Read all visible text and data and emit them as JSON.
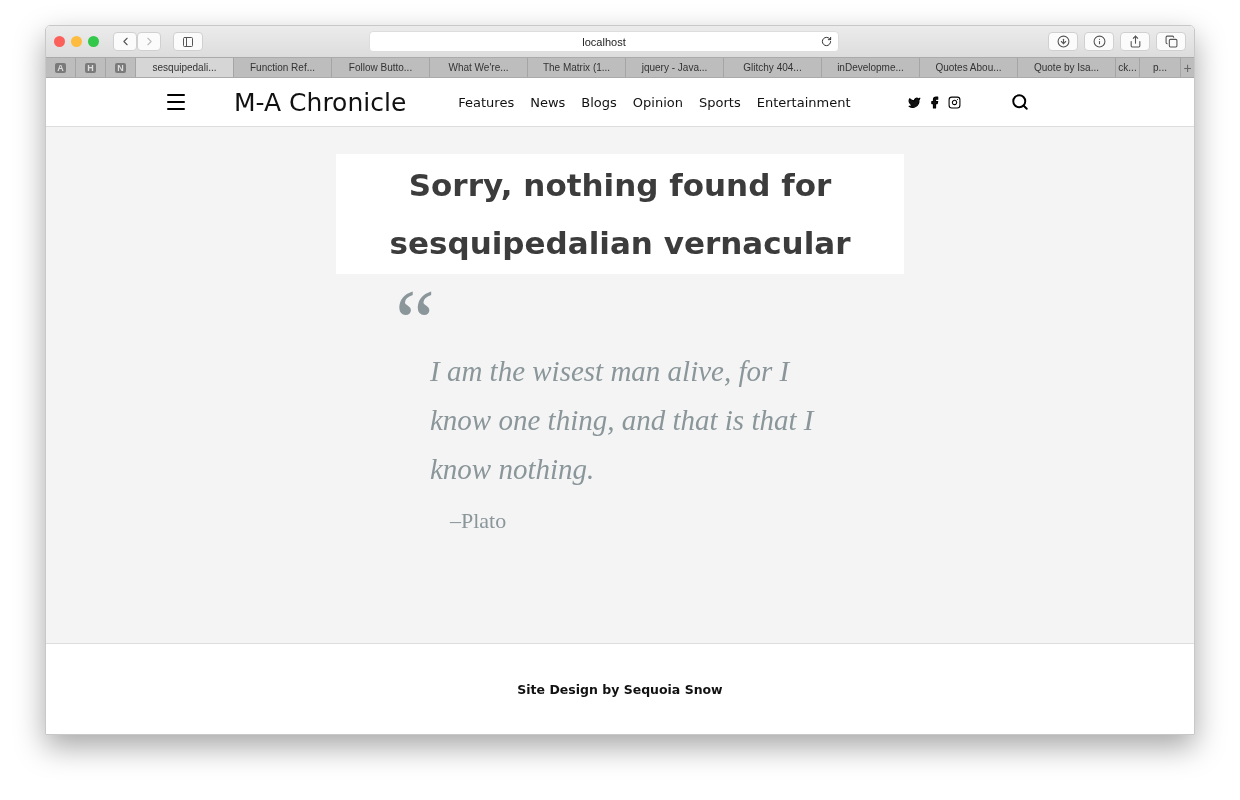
{
  "browser": {
    "address": "localhost",
    "pinned_tabs": [
      "A",
      "H",
      "N"
    ],
    "tabs": [
      {
        "label": "sesquipedali...",
        "selected": true
      },
      {
        "label": "Function Ref...",
        "selected": false
      },
      {
        "label": "Follow Butto...",
        "selected": false
      },
      {
        "label": "What We're...",
        "selected": false
      },
      {
        "label": "The Matrix (1...",
        "selected": false
      },
      {
        "label": "jquery - Java...",
        "selected": false
      },
      {
        "label": "Glitchy 404...",
        "selected": false
      },
      {
        "label": "inDevelopme...",
        "selected": false
      },
      {
        "label": "Quotes Abou...",
        "selected": false
      },
      {
        "label": "Quote by Isa...",
        "selected": false
      },
      {
        "label": "ck...",
        "selected": false
      },
      {
        "label": "p...",
        "selected": false
      }
    ],
    "new_tab": "+"
  },
  "site": {
    "logo": "M-A Chronicle",
    "nav": [
      "Features",
      "News",
      "Blogs",
      "Opinion",
      "Sports",
      "Entertainment"
    ]
  },
  "heading": "Sorry, nothing found for sesquipedalian vernacular",
  "quote": {
    "mark": "“",
    "text": "I am the wisest man alive, for I know one thing, and that is that I know nothing.",
    "author": "–Plato"
  },
  "footer": "Site Design by Sequoia Snow"
}
